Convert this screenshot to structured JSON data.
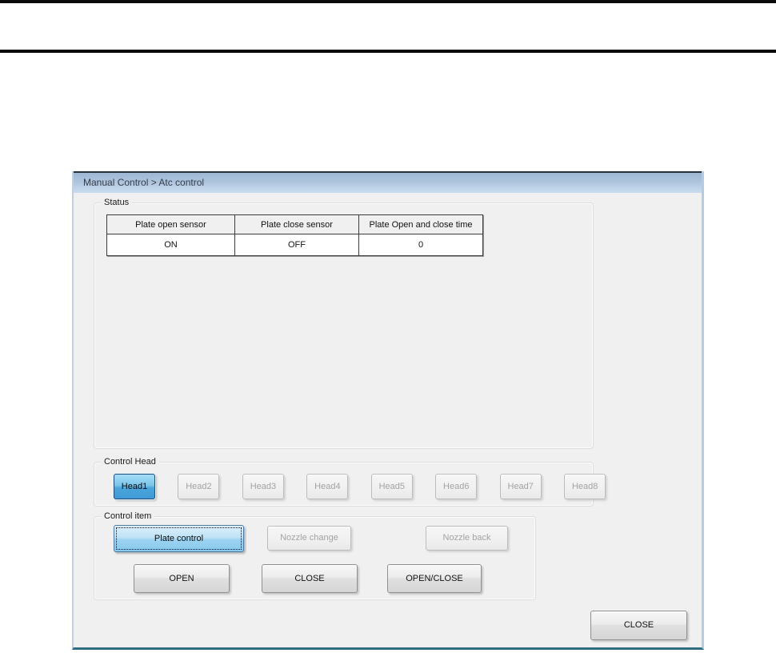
{
  "window": {
    "title": "Manual Control > Atc control"
  },
  "status": {
    "label": "Status",
    "table": {
      "headers": [
        "Plate open sensor",
        "Plate close sensor",
        "Plate Open and close time"
      ],
      "values": [
        "ON",
        "OFF",
        "0"
      ]
    }
  },
  "control_head": {
    "label": "Control Head",
    "buttons": [
      {
        "label": "Head1",
        "state": "active"
      },
      {
        "label": "Head2",
        "state": "disabled"
      },
      {
        "label": "Head3",
        "state": "disabled"
      },
      {
        "label": "Head4",
        "state": "disabled"
      },
      {
        "label": "Head5",
        "state": "disabled"
      },
      {
        "label": "Head6",
        "state": "disabled"
      },
      {
        "label": "Head7",
        "state": "disabled"
      },
      {
        "label": "Head8",
        "state": "disabled"
      }
    ]
  },
  "control_item": {
    "label": "Control item",
    "item_buttons": [
      {
        "label": "Plate control",
        "state": "focused"
      },
      {
        "label": "Nozzle change",
        "state": "disabled"
      },
      {
        "label": "Nozzle back",
        "state": "disabled"
      }
    ],
    "action_buttons": [
      {
        "label": "OPEN"
      },
      {
        "label": "CLOSE"
      },
      {
        "label": "OPEN/CLOSE"
      }
    ]
  },
  "footer": {
    "close_label": "CLOSE"
  },
  "colors": {
    "titlebar_top": "#9db7d3",
    "titlebar_bottom": "#c9dbee",
    "window_bg": "#f0f0f0",
    "window_border_bottom": "#2e6e80",
    "active_button_top": "#a6def7",
    "active_button_bottom": "#3f99d4",
    "focus_button_top": "#ddf0fb",
    "focus_button_bottom": "#88c9ec",
    "disabled_text": "#a3a3a3"
  }
}
